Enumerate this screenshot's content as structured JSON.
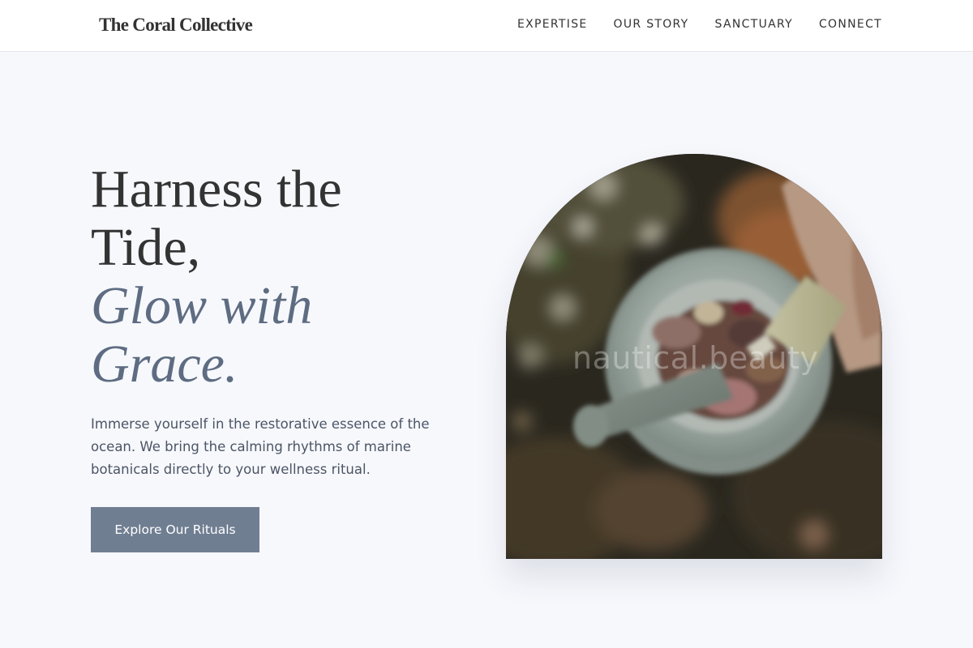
{
  "header": {
    "brand": "The Coral Collective",
    "nav": [
      {
        "label": "EXPERTISE"
      },
      {
        "label": "OUR STORY"
      },
      {
        "label": "SANCTUARY"
      },
      {
        "label": "CONNECT"
      }
    ]
  },
  "hero": {
    "title_line1": "Harness the",
    "title_line2": "Tide,",
    "accent_line1": "Glow with",
    "accent_line2": "Grace.",
    "description": "Immerse yourself in the restorative essence of the ocean. We bring the calming rhythms of marine botanicals directly to your wellness ritual.",
    "cta_label": "Explore Our Rituals",
    "image_watermark": "nautical.beauty"
  },
  "colors": {
    "page_background": "#f7f8fc",
    "accent_text": "#5e6c82",
    "button": "#707e92"
  }
}
